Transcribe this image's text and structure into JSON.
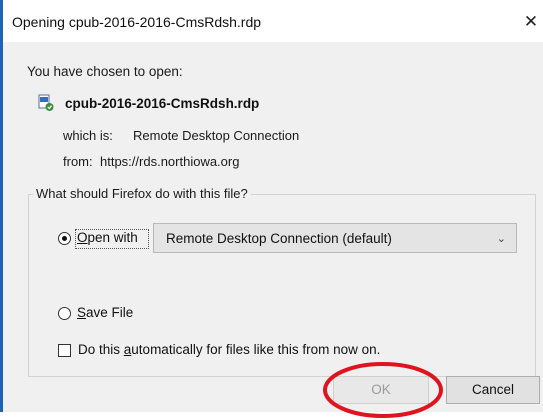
{
  "window": {
    "title": "Opening cpub-2016-2016-CmsRdsh.rdp",
    "close_glyph": "✕"
  },
  "dialog": {
    "chosen_label": "You have chosen to open:",
    "file_name": "cpub-2016-2016-CmsRdsh.rdp",
    "file_icon": "rdp-file-icon",
    "which_label": "which is:",
    "which_value": "Remote Desktop Connection",
    "from_label": "from:",
    "from_value": "https://rds.northiowa.org"
  },
  "action_group": {
    "legend": "What should Firefox do with this file?",
    "open_with_label": {
      "before": "",
      "accel": "O",
      "after": "pen with"
    },
    "open_with_selected": true,
    "app_select_value": "Remote Desktop Connection (default)",
    "save_file_label": {
      "before": "",
      "accel": "S",
      "after": "ave File"
    },
    "save_file_selected": false,
    "auto_label": {
      "before": "Do this ",
      "accel": "a",
      "after": "utomatically for files like this from now on."
    },
    "auto_checked": false
  },
  "buttons": {
    "ok": "OK",
    "cancel": "Cancel"
  },
  "colors": {
    "frame_accent": "#1f63b5",
    "annotation": "#e0141e"
  }
}
